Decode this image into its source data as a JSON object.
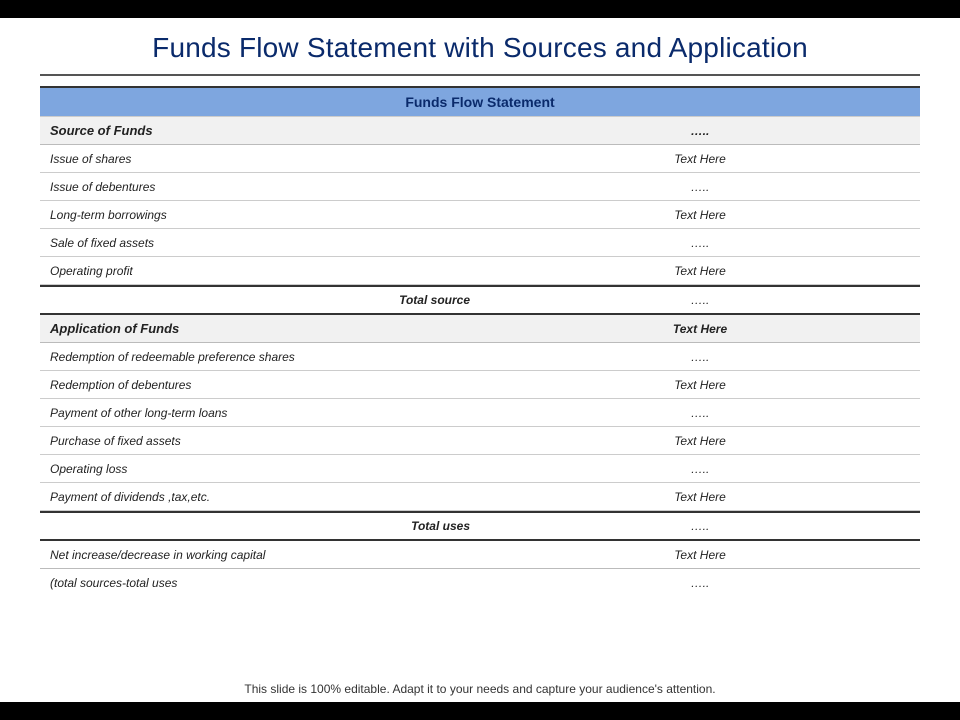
{
  "slide": {
    "title": "Funds Flow Statement with Sources and Application",
    "table_header": "Funds Flow Statement",
    "sections": {
      "sources": {
        "title": "Source of Funds",
        "title_value": "…..",
        "rows": [
          {
            "label": "Issue of shares",
            "value": "Text Here"
          },
          {
            "label": "Issue of debentures",
            "value": "….."
          },
          {
            "label": "Long-term borrowings",
            "value": "Text Here"
          },
          {
            "label": "Sale of fixed assets",
            "value": "….."
          },
          {
            "label": "Operating profit",
            "value": "Text Here"
          }
        ],
        "total_label": "Total source",
        "total_value": "….."
      },
      "applications": {
        "title": "Application  of Funds",
        "title_value": "Text Here",
        "rows": [
          {
            "label": "Redemption of redeemable preference shares",
            "value": "….."
          },
          {
            "label": "Redemption of debentures",
            "value": "Text Here"
          },
          {
            "label": "Payment of other long-term loans",
            "value": "….."
          },
          {
            "label": "Purchase of fixed assets",
            "value": "Text Here"
          },
          {
            "label": "Operating loss",
            "value": "….."
          },
          {
            "label": "Payment of dividends ,tax,etc.",
            "value": "Text Here"
          }
        ],
        "total_label": "Total uses",
        "total_value": "….."
      },
      "summary": {
        "rows": [
          {
            "label": "Net increase/decrease in working capital",
            "value": "Text Here"
          },
          {
            "label": "(total sources-total uses",
            "value": "….."
          }
        ]
      }
    },
    "footer": "This slide is 100% editable. Adapt it to your needs and capture your audience's attention."
  }
}
